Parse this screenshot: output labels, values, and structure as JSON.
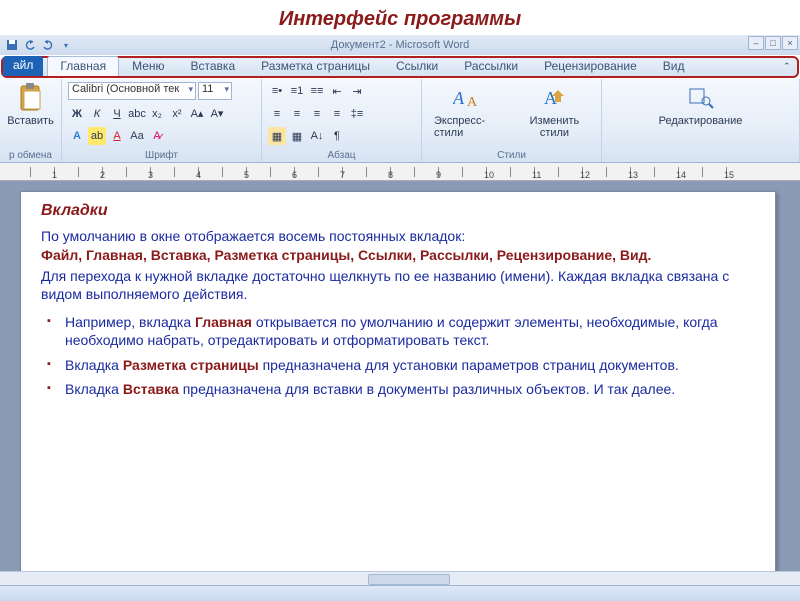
{
  "slide_title": "Интерфейс программы",
  "window_title": "Документ2 - Microsoft Word",
  "tabs": {
    "file": "айл",
    "items": [
      "Главная",
      "Меню",
      "Вставка",
      "Разметка страницы",
      "Ссылки",
      "Рассылки",
      "Рецензирование",
      "Вид"
    ]
  },
  "ribbon": {
    "clipboard": {
      "paste": "Вставить",
      "label": "р обмена"
    },
    "font": {
      "name": "Calibri (Основной тек",
      "size": "11",
      "bold": "Ж",
      "italic": "К",
      "underline": "Ч",
      "label": "Шрифт"
    },
    "paragraph": {
      "label": "Абзац"
    },
    "styles": {
      "quick": "Экспресс-стили",
      "change": "Изменить стили",
      "label": "Стили"
    },
    "editing": {
      "btn": "Редактирование"
    }
  },
  "doc": {
    "heading": "Вкладки",
    "intro": "По умолчанию в окне отображается восемь постоянных вкладок:",
    "tabs_list": "Файл,   Главная,   Вставка,   Разметка страницы,   Ссылки,   Рассылки,   Рецензирование,   Вид.",
    "note": "Для перехода к нужной вкладке достаточно щелкнуть по ее названию (имени). Каждая вкладка связана с видом выполняемого действия.",
    "b1a": "Например, вкладка ",
    "b1k": "Главная",
    "b1b": " открывается по умолчанию  и содержит элементы, необходимые, когда необходимо набрать, отредактировать и отформатировать текст.",
    "b2a": "Вкладка ",
    "b2k": "Разметка страницы",
    "b2b": " предназначена для установки параметров страниц документов.",
    "b3a": " Вкладка ",
    "b3k": "Вставка",
    "b3b": " предназначена для вставки в документы различных объектов. И так далее."
  },
  "ruler_nums": [
    "",
    "1",
    "",
    "2",
    "",
    "3",
    "",
    "4",
    "",
    "5",
    "",
    "6",
    "",
    "7",
    "",
    "8",
    "",
    "9",
    "",
    "10",
    "",
    "11",
    "",
    "12",
    "",
    "13",
    "",
    "14",
    "",
    "15"
  ]
}
